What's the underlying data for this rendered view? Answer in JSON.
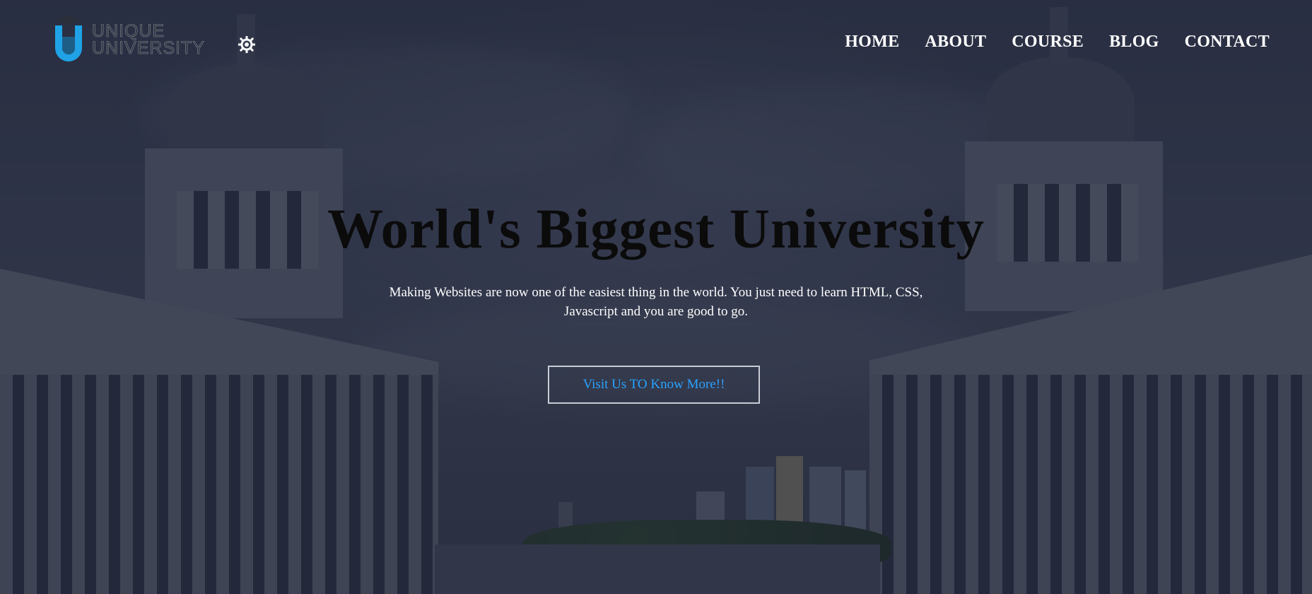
{
  "brand": {
    "name_line1": "UNIQUE",
    "name_line2": "UNIVERSITY",
    "logo_icon": "graduation-u-logo",
    "accent": "#29a3ff"
  },
  "header": {
    "theme_toggle_icon": "sun-icon"
  },
  "nav": {
    "items": [
      {
        "label": "HOME"
      },
      {
        "label": "ABOUT"
      },
      {
        "label": "COURSE"
      },
      {
        "label": "BLOG"
      },
      {
        "label": "CONTACT"
      }
    ]
  },
  "hero": {
    "title": "World's Biggest University",
    "subtitle": "Making Websites are now one of the easiest thing in the world. You just need to learn HTML, CSS, Javascript and you are good to go.",
    "cta_label": "Visit Us TO Know More!!",
    "cta_color": "#29a3ff",
    "background_icon": "university-colonnade-photo"
  }
}
